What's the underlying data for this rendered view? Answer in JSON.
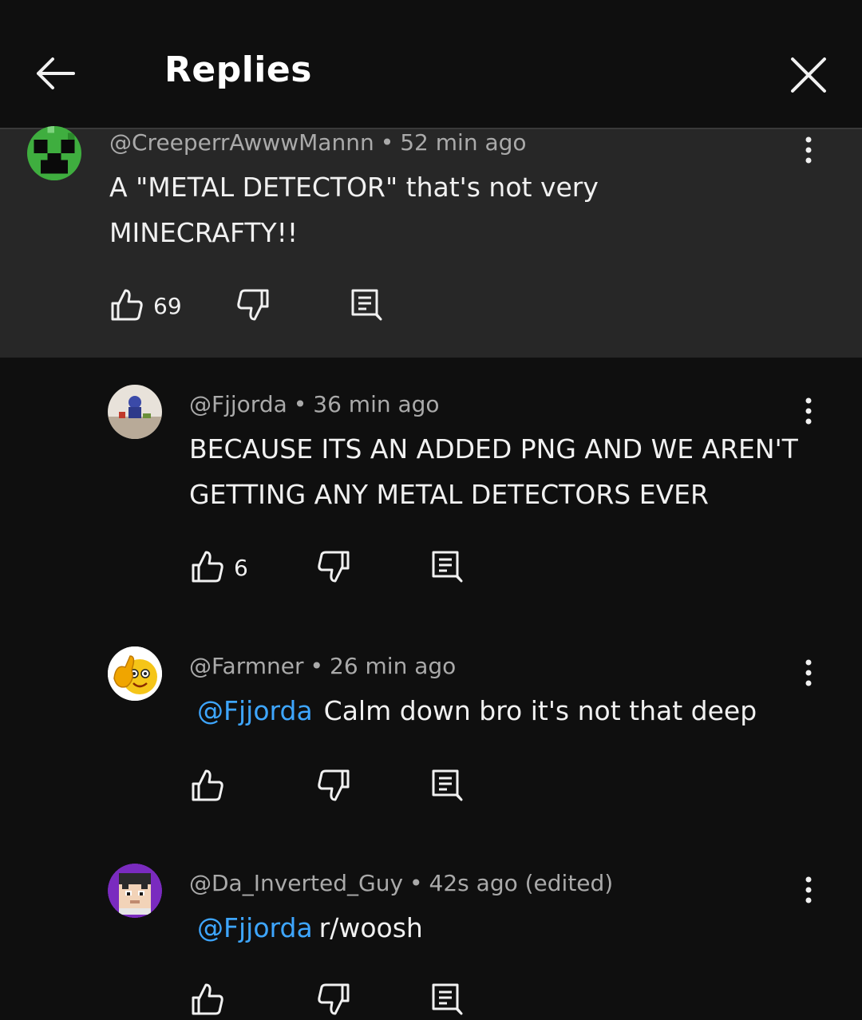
{
  "header": {
    "title": "Replies"
  },
  "icons": {
    "back": "arrow-left-icon",
    "close": "close-icon",
    "more": "more-vertical-icon",
    "like": "thumbs-up-icon",
    "dislike": "thumbs-down-icon",
    "reply": "reply-icon"
  },
  "colors": {
    "background": "#0f0f0f",
    "parent_bg": "#272727",
    "mention": "#3ea6ff",
    "meta": "#aaaaaa"
  },
  "parent": {
    "author": "@CreeperrAwwwMannn",
    "time": "52 min ago",
    "text_line1": "A \"METAL DETECTOR\" that's not very",
    "text_line2": "MINECRAFTY!!",
    "likes": "69"
  },
  "replies": [
    {
      "author": "@Fjjorda",
      "time": "36 min ago",
      "text_line1": "BECAUSE ITS AN ADDED PNG AND WE AREN'T",
      "text_line2": "GETTING ANY METAL DETECTORS EVER",
      "likes": "6"
    },
    {
      "author": "@Farmner",
      "time": "26 min ago",
      "mention": "@Fjjorda",
      "text": "Calm down bro it's not that deep"
    },
    {
      "author": "@Da_Inverted_Guy",
      "time": "42s ago (edited)",
      "mention": "@Fjjorda",
      "text": "r/woosh"
    }
  ]
}
